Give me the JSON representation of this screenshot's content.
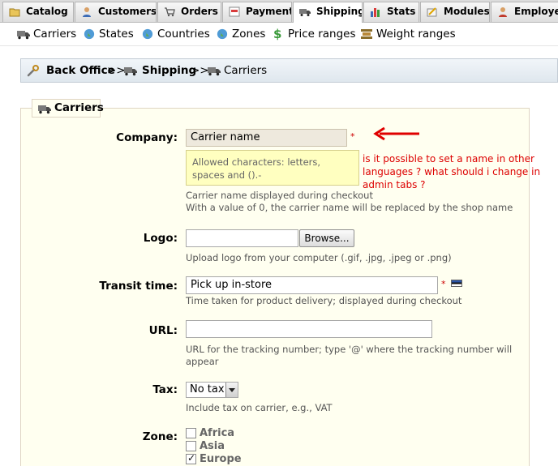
{
  "tabs": [
    {
      "label": "Catalog",
      "icon": "folder-icon",
      "active": false
    },
    {
      "label": "Customers",
      "icon": "customer-icon",
      "active": false
    },
    {
      "label": "Orders",
      "icon": "cart-icon",
      "active": false
    },
    {
      "label": "Payment",
      "icon": "payment-icon",
      "active": false
    },
    {
      "label": "Shipping",
      "icon": "truck-icon",
      "active": true
    },
    {
      "label": "Stats",
      "icon": "stats-icon",
      "active": false
    },
    {
      "label": "Modules",
      "icon": "modules-icon",
      "active": false
    },
    {
      "label": "Employee",
      "icon": "employee-icon",
      "active": false
    }
  ],
  "subnav": [
    {
      "label": "Carriers",
      "icon": "truck-icon"
    },
    {
      "label": "States",
      "icon": "globe-icon"
    },
    {
      "label": "Countries",
      "icon": "globe-icon"
    },
    {
      "label": "Zones",
      "icon": "globe-icon"
    },
    {
      "label": "Price ranges",
      "icon": "dollar-icon"
    },
    {
      "label": "Weight ranges",
      "icon": "weight-icon"
    }
  ],
  "breadcrumb": {
    "root": "Back Office",
    "sep1": ">>",
    "section": "Shipping",
    "sep2": ">>",
    "current": "Carriers"
  },
  "legend": "Carriers",
  "form": {
    "company": {
      "label": "Company:",
      "value": "Carrier name",
      "required": "*",
      "tooltip": "Allowed characters: letters, spaces and ().-",
      "hint1": "Carrier name displayed during checkout",
      "hint2": "With a value of 0, the carrier name will be replaced by the shop name"
    },
    "logo": {
      "label": "Logo:",
      "browse": "Browse...",
      "hint": "Upload logo from your computer (.gif, .jpg, .jpeg or .png)"
    },
    "transit": {
      "label": "Transit time:",
      "value": "Pick up in-store",
      "required": "*",
      "hint": "Time taken for product delivery; displayed during checkout"
    },
    "url": {
      "label": "URL:",
      "value": "",
      "hint1": "URL for the tracking number; type '@' where the tracking number will",
      "hint2": "appear"
    },
    "tax": {
      "label": "Tax:",
      "value": "No tax",
      "hint": "Include tax on carrier, e.g., VAT"
    },
    "zone": {
      "label": "Zone:",
      "options": [
        {
          "label": "Africa",
          "checked": false
        },
        {
          "label": "Asia",
          "checked": false
        },
        {
          "label": "Europe",
          "checked": true
        }
      ]
    }
  },
  "annotation": {
    "line1": "is it possible to set a name in other",
    "line2": "languages ? what should i change in",
    "line3": "admin tabs ?"
  },
  "colors": {
    "annotation": "#dd0000",
    "fieldset_bg": "#fffff0",
    "required": "#cc0000"
  }
}
